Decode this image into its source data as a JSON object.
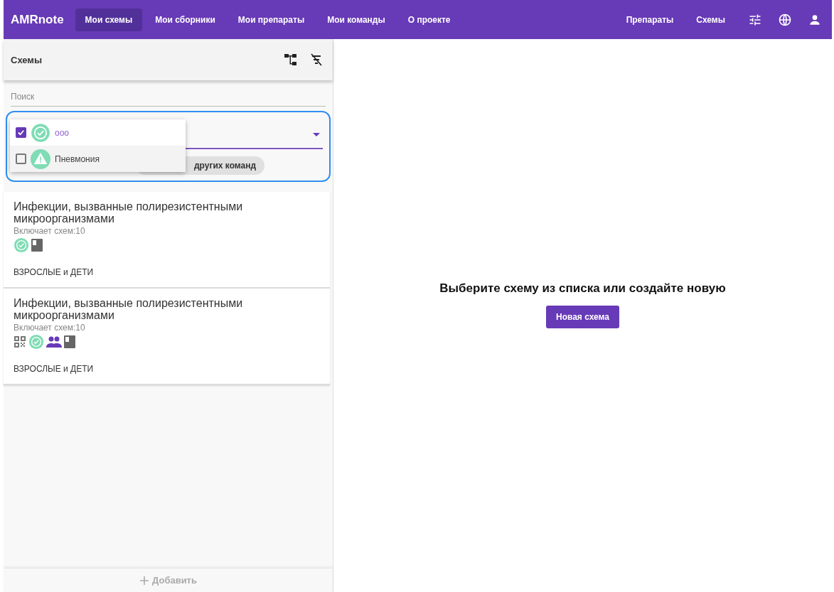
{
  "navbar": {
    "brand": "AMRnote",
    "links": [
      {
        "label": "Мои схемы",
        "selected": true
      },
      {
        "label": "Мои сборники",
        "selected": false
      },
      {
        "label": "Мои препараты",
        "selected": false
      },
      {
        "label": "Мои команды",
        "selected": false
      },
      {
        "label": "О проекте",
        "selected": false
      }
    ],
    "right_links": [
      "Препараты",
      "Схемы"
    ]
  },
  "sidebar": {
    "title": "Схемы",
    "search": {
      "placeholder": "Поиск"
    },
    "tag_menu": [
      {
        "label": "ооо",
        "checked": true,
        "kind": "verified"
      },
      {
        "label": "Пневмония",
        "checked": false,
        "kind": "warning"
      }
    ],
    "chip": "других команд",
    "cards": [
      {
        "title": "Инфекции, вызванные полирезистентными микроорганизмами",
        "count": "Включает схем:10",
        "icons": [
          {
            "kind": "verified"
          },
          {
            "kind": "book"
          }
        ],
        "audience": "ВЗРОСЛЫЕ и ДЕТИ"
      },
      {
        "title": "Инфекции, вызванные полирезистентными микроорганизмами",
        "count": "Включает схем:10",
        "icons": [
          {
            "kind": "qr"
          },
          {
            "kind": "verified"
          },
          {
            "kind": "team"
          },
          {
            "kind": "book"
          }
        ],
        "audience": "ВЗРОСЛЫЕ и ДЕТИ"
      }
    ],
    "add_button": "Добавить"
  },
  "main": {
    "message": "Выберите схему из списка или создайте новую",
    "button": "Новая схема"
  }
}
